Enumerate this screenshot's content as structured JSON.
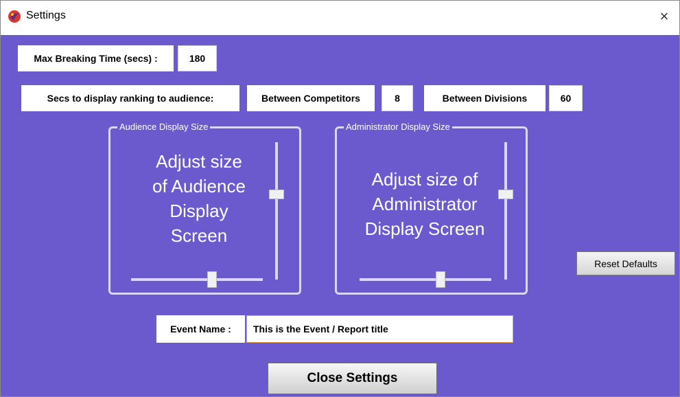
{
  "window": {
    "title": "Settings",
    "close_glyph": "×",
    "icon": "app-icon"
  },
  "max_breaking_time": {
    "label": "Max Breaking Time (secs) :",
    "value": "180"
  },
  "ranking_display": {
    "label": "Secs to display ranking to audience:",
    "between_competitors_label": "Between Competitors",
    "between_competitors_value": "8",
    "between_divisions_label": "Between Divisions",
    "between_divisions_value": "60"
  },
  "audience_display": {
    "legend": "Audience Display Size",
    "text_lines": [
      "Adjust size",
      "of Audience",
      "Display",
      "Screen"
    ],
    "vertical_slider_level": 0.6,
    "horizontal_slider_level": 0.6
  },
  "administrator_display": {
    "legend": "Administrator Display Size",
    "text_lines": [
      "Adjust size of",
      "Administrator",
      "Display Screen"
    ],
    "vertical_slider_level": 0.6,
    "horizontal_slider_level": 0.6
  },
  "reset_button": {
    "label": "Reset Defaults"
  },
  "event_name": {
    "label": "Event Name :",
    "value": "This is the Event / Report title"
  },
  "close_button": {
    "label": "Close Settings"
  },
  "colors": {
    "background": "#6a5acd",
    "group_border": "#d9d6ff",
    "input_border": "#e6a64a"
  }
}
